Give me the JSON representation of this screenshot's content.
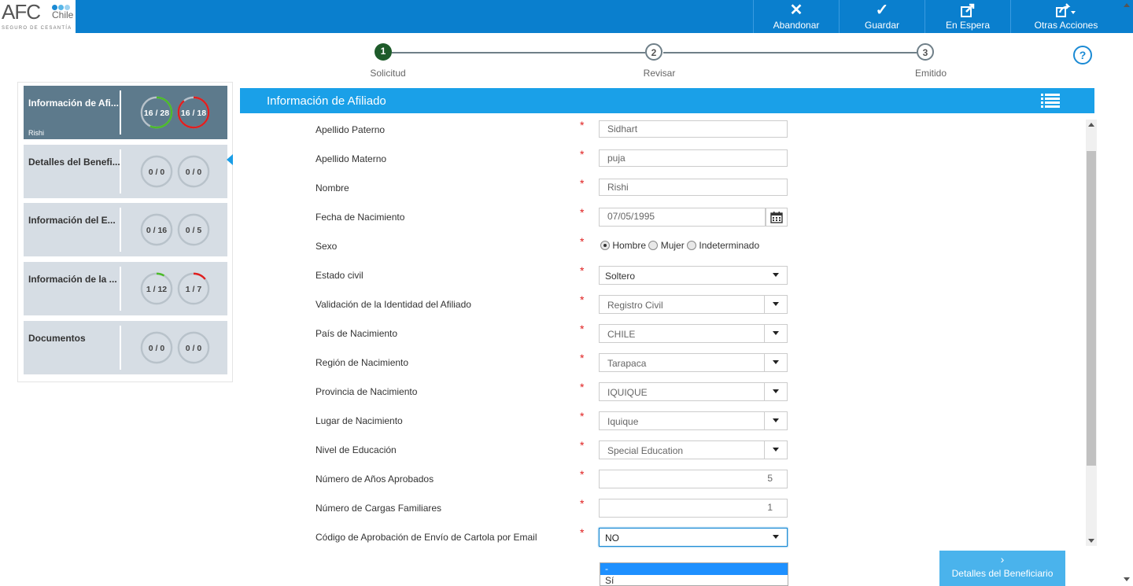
{
  "brand": {
    "name": "AFC",
    "country": "Chile",
    "tagline": "SEGURO DE CESANTÍA",
    "dot_colors": [
      "#1a8ad4",
      "#59b7e8",
      "#9dd3f1"
    ]
  },
  "toolbar": [
    {
      "label": "Abandonar",
      "icon": "close-icon"
    },
    {
      "label": "Guardar",
      "icon": "check-icon"
    },
    {
      "label": "En Espera",
      "icon": "export-icon"
    },
    {
      "label": "Otras Acciones",
      "icon": "share-dropdown-icon"
    }
  ],
  "steps": [
    {
      "num": "1",
      "label": "Solicitud",
      "active": true
    },
    {
      "num": "2",
      "label": "Revisar",
      "active": false
    },
    {
      "num": "3",
      "label": "Emitido",
      "active": false
    }
  ],
  "help": {
    "glyph": "?"
  },
  "sidebar": [
    {
      "title": "Información de Afi...",
      "subtitle": "Rishi",
      "ring1": "16 / 28",
      "ring2": "16 / 18",
      "ring1_frac": 0.57,
      "ring2_frac": 0.89,
      "active": true
    },
    {
      "title": "Detalles del Benefi...",
      "subtitle": "",
      "ring1": "0 / 0",
      "ring2": "0 / 0",
      "ring1_frac": 0,
      "ring2_frac": 0,
      "active": false
    },
    {
      "title": "Información del E...",
      "subtitle": "",
      "ring1": "0 / 16",
      "ring2": "0 / 5",
      "ring1_frac": 0,
      "ring2_frac": 0,
      "active": false
    },
    {
      "title": "Información de la ...",
      "subtitle": "",
      "ring1": "1 / 12",
      "ring2": "1 / 7",
      "ring1_frac": 0.083,
      "ring2_frac": 0.14,
      "active": false
    },
    {
      "title": "Documentos",
      "subtitle": "",
      "ring1": "0 / 0",
      "ring2": "0 / 0",
      "ring1_frac": 0,
      "ring2_frac": 0,
      "active": false
    }
  ],
  "colors": {
    "ring_green": "#4cbb2a",
    "ring_red": "#e01f1f",
    "ring_grey": "#b8c2ca",
    "header_blue": "#1aa0e8",
    "topbar_blue": "#0a7fce"
  },
  "section": {
    "title": "Información de Afiliado"
  },
  "form": {
    "apellido_paterno": {
      "label": "Apellido Paterno",
      "value": "Sidhart"
    },
    "apellido_materno": {
      "label": "Apellido Materno",
      "value": "puja"
    },
    "nombre": {
      "label": "Nombre",
      "value": "Rishi"
    },
    "fecha_nacimiento": {
      "label": "Fecha de Nacimiento",
      "value": "07/05/1995"
    },
    "sexo": {
      "label": "Sexo",
      "options": [
        "Hombre",
        "Mujer",
        "Indeterminado"
      ],
      "selected": "Hombre"
    },
    "estado_civil": {
      "label": "Estado civil",
      "value": "Soltero"
    },
    "validacion": {
      "label": "Validación de la Identidad del Afiliado",
      "value": "Registro Civil"
    },
    "pais": {
      "label": "País de Nacimiento",
      "value": "CHILE"
    },
    "region": {
      "label": "Región de Nacimiento",
      "value": "Tarapaca"
    },
    "provincia": {
      "label": "Provincia de Nacimiento",
      "value": "IQUIQUE"
    },
    "lugar": {
      "label": "Lugar de Nacimiento",
      "value": "Iquique"
    },
    "nivel_educacion": {
      "label": "Nivel de Educación",
      "value": "Special Education"
    },
    "anos_aprobados": {
      "label": "Número de Años Aprobados",
      "value": "5"
    },
    "cargas": {
      "label": "Número de Cargas Familiares",
      "value": "1"
    },
    "cartola": {
      "label": "Código de Aprobación de Envío de Cartola por Email",
      "value": "NO"
    }
  },
  "required_mark": "*",
  "dropdown_options": [
    "-",
    "Sí"
  ],
  "next_button": {
    "label": "Detalles del Beneficiario",
    "chevron": "›"
  }
}
